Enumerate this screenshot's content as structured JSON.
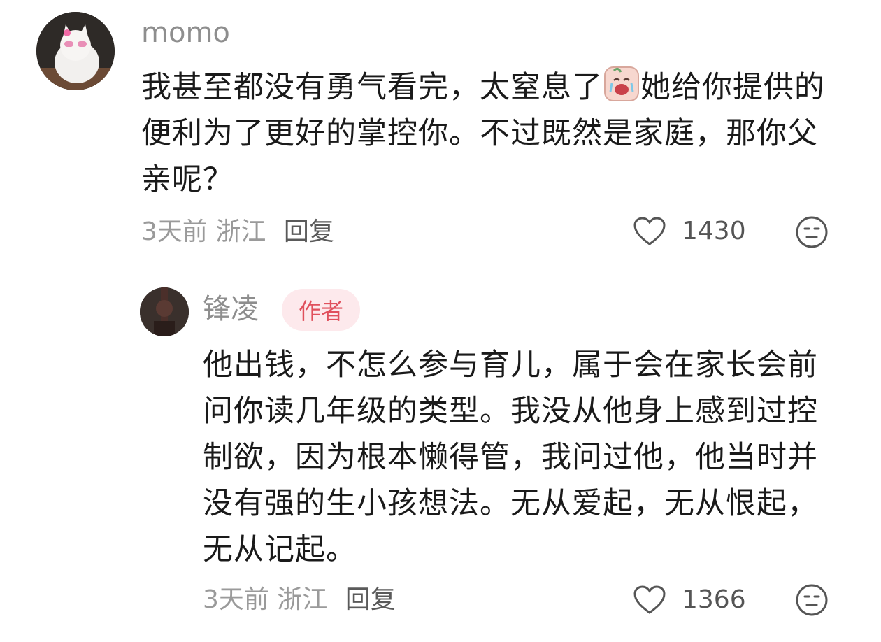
{
  "comment1": {
    "username": "momo",
    "text_a": "我甚至都没有勇气看完，太窒息了",
    "emoji": "crying-face-emoji",
    "text_b": "她给你提供的便利为了更好的掌控你。不过既然是家庭，那你父亲呢？",
    "time": "3天前",
    "location": "浙江",
    "reply_label": "回复",
    "likes": "1430"
  },
  "comment2": {
    "username": "锋凌",
    "badge": "作者",
    "text": "他出钱，不怎么参与育儿，属于会在家长会前问你读几年级的类型。我没从他身上感到过控制欲，因为根本懒得管，我问过他，他当时并没有强的生小孩想法。无从爱起，无从恨起，无从记起。",
    "time": "3天前",
    "location": "浙江",
    "reply_label": "回复",
    "likes": "1366"
  },
  "colors": {
    "badge_bg": "#fde9ec",
    "badge_text": "#e0505c",
    "meta": "#9a9a9a"
  },
  "icons": [
    "heart-icon",
    "dislike-face-icon"
  ]
}
